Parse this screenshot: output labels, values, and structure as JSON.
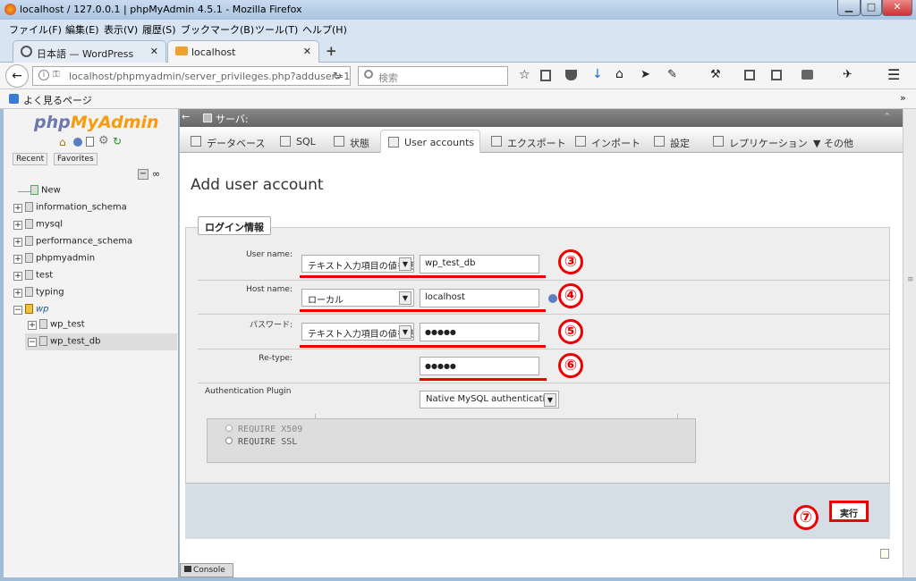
{
  "window": {
    "title": "localhost / 127.0.0.1 | phpMyAdmin 4.5.1 - Mozilla Firefox"
  },
  "menu": [
    "ファイル(F)",
    "編集(E)",
    "表示(V)",
    "履歴(S)",
    "ブックマーク(B)",
    "ツール(T)",
    "ヘルプ(H)"
  ],
  "tabs": [
    {
      "label": "日本語 — WordPress"
    },
    {
      "label": "localhost"
    }
  ],
  "nav": {
    "url": "localhost/phpmyadmin/server_privileges.php?adduser=1&",
    "search_placeholder": "検索"
  },
  "bookmarks": {
    "label": "よく見るページ"
  },
  "sidebar": {
    "logo_php": "php",
    "logo_myadmin": "MyAdmin",
    "recent": "Recent",
    "favorites": "Favorites",
    "tree": [
      {
        "label": "New"
      },
      {
        "label": "information_schema"
      },
      {
        "label": "mysql"
      },
      {
        "label": "performance_schema"
      },
      {
        "label": "phpmyadmin"
      },
      {
        "label": "test"
      },
      {
        "label": "typing"
      },
      {
        "label": "wp"
      },
      {
        "label": "wp_test"
      },
      {
        "label": "wp_test_db"
      }
    ]
  },
  "server_bar": {
    "label": "サーバ:"
  },
  "pma_tabs": [
    "データベース",
    "SQL",
    "状態",
    "User accounts",
    "エクスポート",
    "インポート",
    "設定",
    "レプリケーション",
    "その他"
  ],
  "page": {
    "title": "Add user account"
  },
  "form": {
    "legend": "ログイン情報",
    "user_name_label": "User name:",
    "user_name_select": "テキスト入力項目の値を使用",
    "user_name_value": "wp_test_db",
    "host_name_label": "Host name:",
    "host_name_select": "ローカル",
    "host_name_value": "localhost",
    "password_label": "パスワード:",
    "password_select": "テキスト入力項目の値を使用",
    "password_value": "●●●●●",
    "retype_label": "Re-type:",
    "retype_value": "●●●●●",
    "auth_label": "Authentication Plugin",
    "auth_select": "Native MySQL authentication",
    "ssl_options": [
      "REQUIRE X509",
      "REQUIRE SSL"
    ],
    "submit": "実行"
  },
  "annotations": [
    "③",
    "④",
    "⑤",
    "⑥",
    "⑦"
  ],
  "console": {
    "label": "Console"
  },
  "colors": {
    "accent_red": "#e00000",
    "pma_blue": "#6c78af"
  }
}
